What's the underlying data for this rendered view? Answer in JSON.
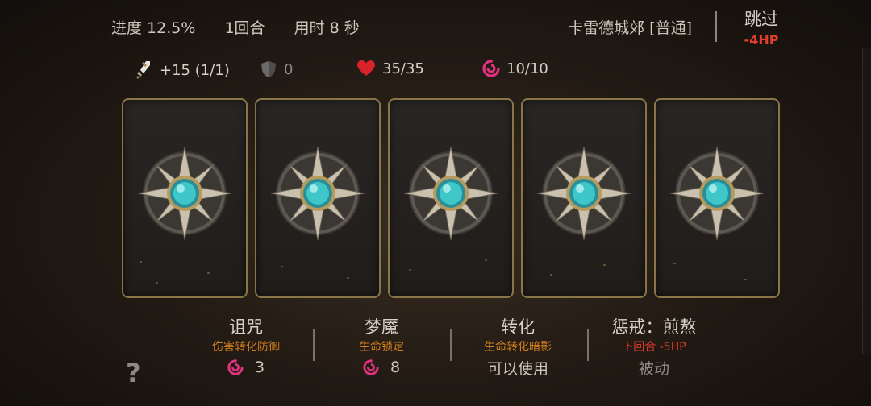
{
  "header": {
    "progress": "进度 12.5%",
    "round": "1回合",
    "time": "用时 8 秒",
    "location": "卡雷德城郊 [普通]",
    "skip_label": "跳过",
    "skip_cost": "-4HP"
  },
  "stats": {
    "attack": "+15 (1/1)",
    "armor": "0",
    "health": "35/35",
    "mana": "10/10"
  },
  "cards": [
    {
      "state": "face-down"
    },
    {
      "state": "face-down"
    },
    {
      "state": "face-down"
    },
    {
      "state": "face-down"
    },
    {
      "state": "face-down"
    }
  ],
  "skills": [
    {
      "name": "诅咒",
      "desc": "伤害转化防御",
      "cost": "3"
    },
    {
      "name": "梦魇",
      "desc": "生命锁定",
      "cost": "8"
    },
    {
      "name": "转化",
      "desc": "生命转化暗影",
      "status": "可以使用"
    },
    {
      "name": "惩戒：煎熬",
      "desc": "下回合 -5HP",
      "status": "被动"
    }
  ],
  "help_label": "?",
  "colors": {
    "accent_orange": "#d07d1c",
    "danger_red": "#e03a2a",
    "card_border": "#8a7547",
    "gem_teal": "#3fc6c9",
    "mana_pink": "#e0327e"
  }
}
